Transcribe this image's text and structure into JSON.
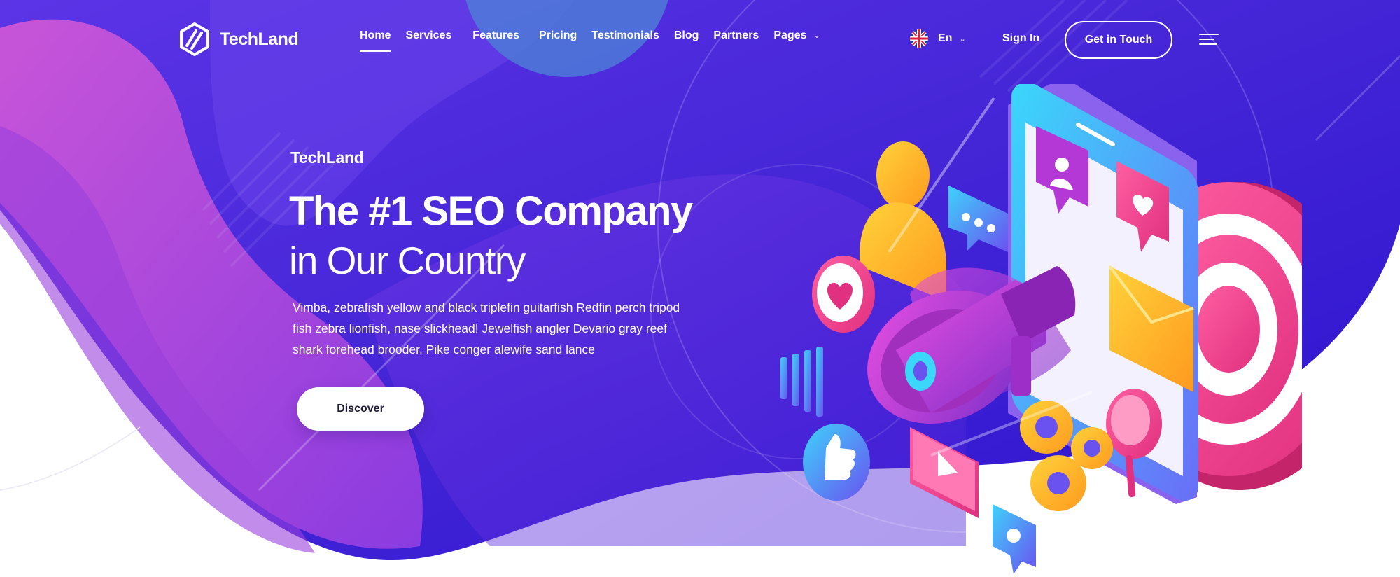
{
  "brand": {
    "name": "TechLand",
    "logo_icon": "hexagon-stripes-logo"
  },
  "nav": {
    "items": [
      {
        "label": "Home",
        "active": true
      },
      {
        "label": "Services"
      },
      {
        "label": "Features"
      },
      {
        "label": "Pricing"
      },
      {
        "label": "Testimonials"
      },
      {
        "label": "Blog"
      },
      {
        "label": "Partners"
      },
      {
        "label": "Pages",
        "has_dropdown": true
      }
    ],
    "language": {
      "label": "En",
      "flag_icon": "uk-flag-icon"
    },
    "sign_in": "Sign In",
    "cta": "Get in Touch",
    "menu_icon": "hamburger-menu-icon"
  },
  "hero": {
    "eyebrow": "TechLand",
    "title": "The #1 SEO Company",
    "subtitle": "in Our Country",
    "text": "Vimba, zebrafish yellow and black triplefin guitarfish Redfin perch tripod fish zebra lionfish, nase slickhead! Jewelfish angler Devario gray reef shark forehead brooder. Pike conger alewife sand lance",
    "button": "Discover"
  },
  "colors": {
    "hero_blue": "#3b1fd6",
    "hero_violet": "#6b2fe0",
    "hero_magenta": "#b54bd6",
    "accent_pink": "#f23d8f",
    "accent_yellow": "#ffb726",
    "accent_cyan": "#35d7f7"
  },
  "illustration": {
    "icons": [
      "smartphone-icon",
      "megaphone-icon",
      "target-icon",
      "user-icon",
      "chat-bubble-icon",
      "heart-icon",
      "like-icon",
      "mail-icon",
      "gear-icon",
      "search-icon",
      "play-icon",
      "location-pin-icon",
      "bar-chart-icon"
    ]
  }
}
